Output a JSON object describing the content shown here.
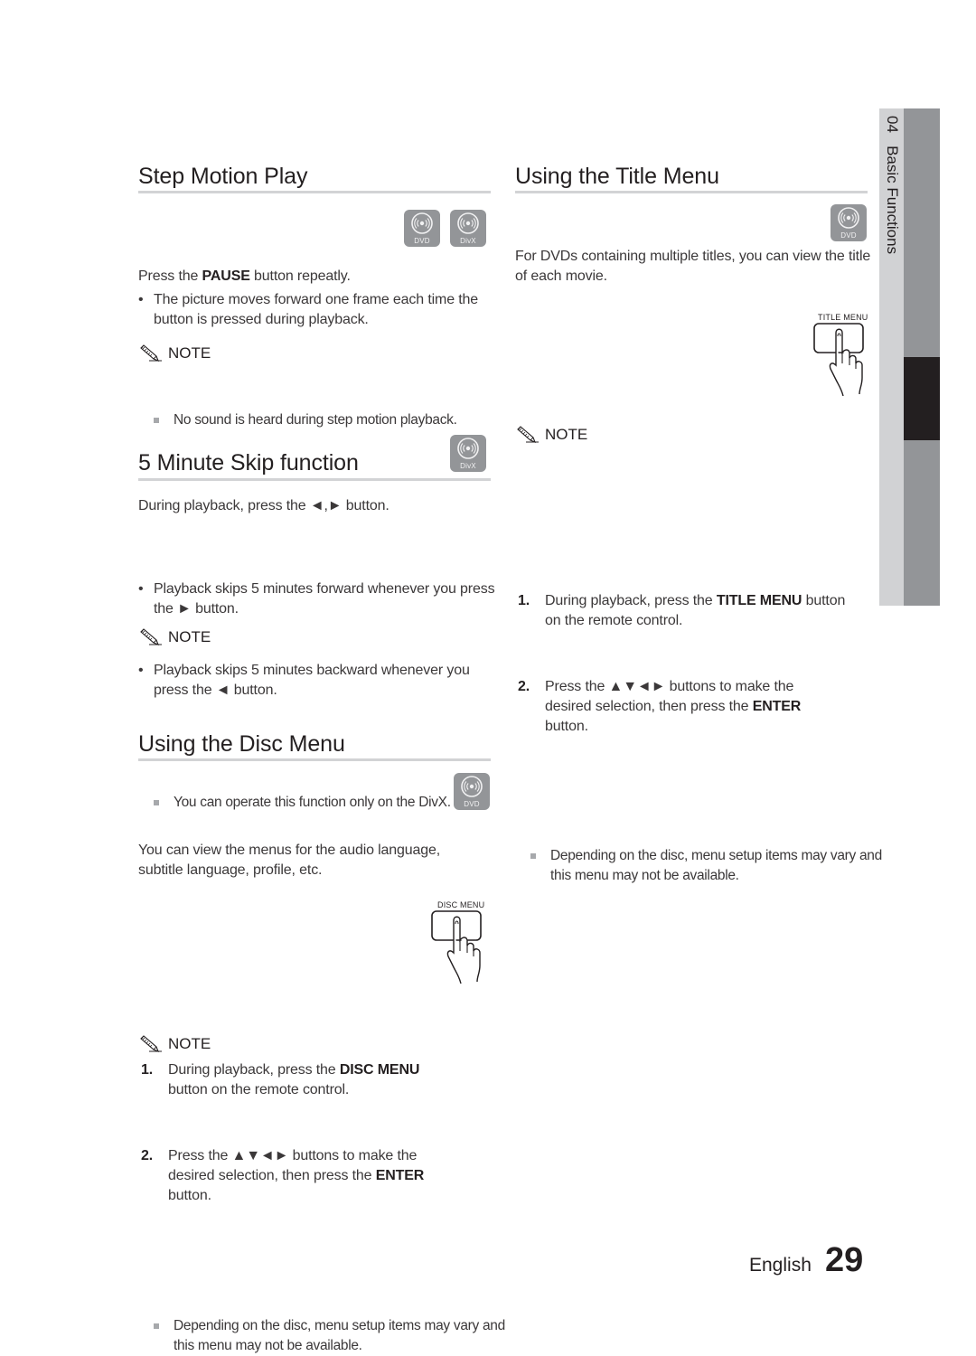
{
  "page": {
    "language": "English",
    "page_number": "29"
  },
  "side_tab": {
    "chapter_number": "04",
    "chapter_title": "Basic Functions"
  },
  "sections": {
    "step_motion": {
      "title": "Step Motion Play",
      "badges": [
        "DVD",
        "DivX"
      ],
      "intro_pre": "Press the ",
      "intro_bold": "PAUSE",
      "intro_post": " button repeatly.",
      "bullets": [
        "The picture moves forward one frame each time the button is pressed during playback."
      ],
      "note_title": "NOTE",
      "notes": [
        "No sound is heard during step motion playback."
      ]
    },
    "five_minute_skip": {
      "title": "5 Minute Skip function",
      "badges": [
        "DivX"
      ],
      "intro": "During playback, press the ◄,► button.",
      "bullets": [
        "Playback skips 5 minutes forward whenever you press the ► button.",
        "Playback skips 5 minutes backward whenever you press the ◄ button."
      ],
      "note_title": "NOTE",
      "notes": [
        "You can operate this function only on the DivX."
      ]
    },
    "disc_menu": {
      "title": "Using the Disc Menu",
      "badges": [
        "DVD"
      ],
      "intro": "You can view the menus for the audio language, subtitle language, profile, etc.",
      "steps": [
        {
          "num": "1.",
          "pre": "During playback, press the ",
          "bold": "DISC MENU",
          "post": " button on the remote control."
        },
        {
          "num": "2.",
          "pre": "Press the ▲▼◄► buttons to make the desired selection, then press the ",
          "bold": "ENTER",
          "post": " button."
        }
      ],
      "remote_button_label": "DISC MENU",
      "note_title": "NOTE",
      "notes": [
        "Depending on the disc, menu setup items may vary and this menu may not be available."
      ]
    },
    "title_menu": {
      "title": "Using the Title Menu",
      "badges": [
        "DVD"
      ],
      "intro": "For DVDs containing multiple titles, you can view the title of each movie.",
      "steps": [
        {
          "num": "1.",
          "pre": " During playback, press the ",
          "bold": "TITLE MENU",
          "post": " button on the remote control."
        },
        {
          "num": "2.",
          "pre": "Press the ▲▼◄► buttons to make the desired selection, then press the ",
          "bold": "ENTER",
          "post": " button."
        }
      ],
      "remote_button_label": "TITLE MENU",
      "note_title": "NOTE",
      "notes": [
        "Depending on the disc, menu setup items may vary and this menu may not be available."
      ]
    }
  },
  "icons": {
    "disc": "disc-icon",
    "note": "pencil-note-icon",
    "hand": "hand-press-icon"
  },
  "colors": {
    "text": "#231f20",
    "body_text": "#3b3839",
    "rule": "#d2d3d5",
    "badge": "#939598",
    "tab_light": "#d1d2d4",
    "tab_dark": "#939598",
    "tab_active": "#231f20"
  }
}
